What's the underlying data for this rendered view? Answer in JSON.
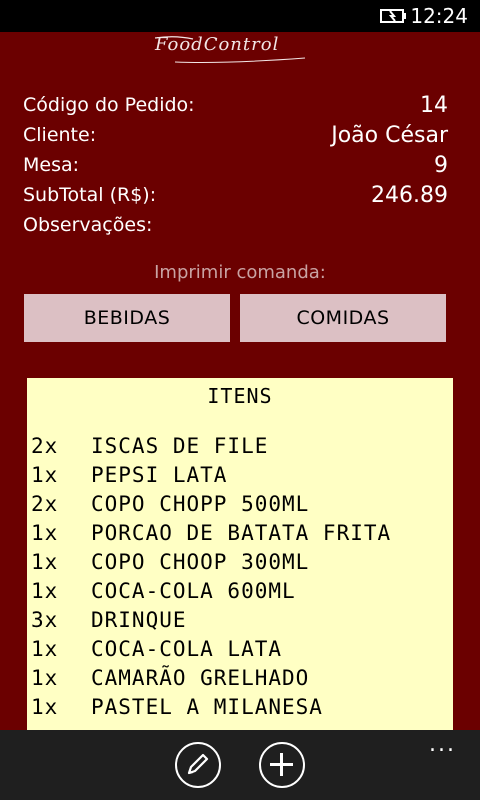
{
  "status_bar": {
    "time": "12:24"
  },
  "logo": {
    "text": "FoodControl"
  },
  "order": {
    "fields": [
      {
        "label": "Código do Pedido:",
        "value": "14"
      },
      {
        "label": "Cliente:",
        "value": "João César"
      },
      {
        "label": "Mesa:",
        "value": "9"
      },
      {
        "label": "SubTotal (R$):",
        "value": "246.89"
      },
      {
        "label": "Observações:",
        "value": ""
      }
    ]
  },
  "print": {
    "label": "Imprimir comanda:",
    "buttons": {
      "bebidas": "BEBIDAS",
      "comidas": "COMIDAS"
    }
  },
  "receipt": {
    "title": "ITENS",
    "items": [
      {
        "qty": "2x",
        "name": "ISCAS DE FILE"
      },
      {
        "qty": "1x",
        "name": "PEPSI LATA"
      },
      {
        "qty": "2x",
        "name": "COPO CHOPP 500ML"
      },
      {
        "qty": "1x",
        "name": "PORCAO DE BATATA FRITA"
      },
      {
        "qty": "1x",
        "name": "COPO CHOOP 300ML"
      },
      {
        "qty": "1x",
        "name": "COCA-COLA 600ML"
      },
      {
        "qty": "3x",
        "name": "DRINQUE"
      },
      {
        "qty": "1x",
        "name": "COCA-COLA LATA"
      },
      {
        "qty": "1x",
        "name": "CAMARÃO GRELHADO"
      },
      {
        "qty": "1x",
        "name": "PASTEL A MILANESA"
      }
    ]
  },
  "appbar": {
    "icons": [
      "edit-icon",
      "add-icon",
      "more-icon"
    ],
    "more": "..."
  }
}
